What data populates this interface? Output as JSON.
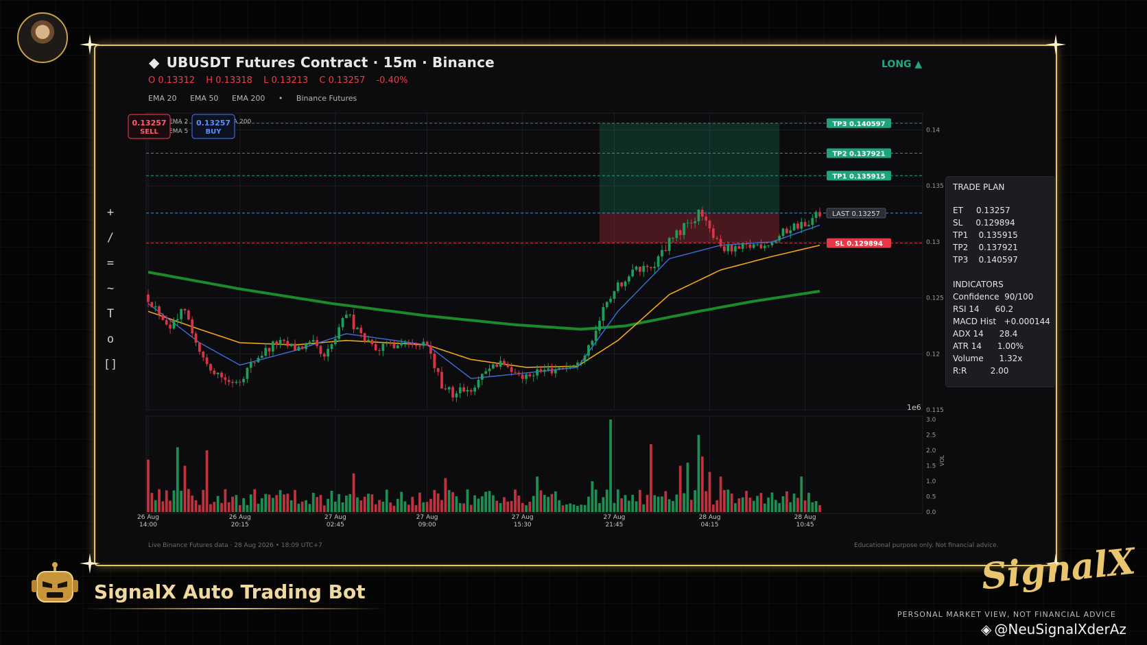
{
  "header": {
    "title": "UBUSDT Futures Contract  ·  15m  ·  Binance",
    "title_icon": "diamond-icon",
    "direction": "LONG ▲",
    "ohlc": {
      "o": "O 0.13312",
      "h": "H 0.13318",
      "l": "L 0.13213",
      "c": "C 0.13257",
      "chg": "-0.40%"
    },
    "legend": {
      "ema20": "EMA 20",
      "ema50": "EMA 50",
      "ema200": "EMA 200",
      "dot": "•",
      "source": "Binance Futures"
    }
  },
  "tools": [
    "+",
    "/",
    "=",
    "~",
    "T",
    "o",
    "[]"
  ],
  "overlay": {
    "sell_price": "0.13257",
    "sell_label": "SELL",
    "buy_price": "0.13257",
    "buy_label": "BUY",
    "legend_frag_1": "EMA 2",
    "legend_frag_2": "EMA 5",
    "legend_frag_3": "A 200"
  },
  "trade_plan": {
    "title": "TRADE PLAN",
    "rows": [
      "ET     0.13257",
      "SL     0.129894",
      "TP1    0.135915",
      "TP2    0.137921",
      "TP3    0.140597"
    ],
    "indicators_title": "INDICATORS",
    "indicators": [
      "Confidence  90/100",
      "RSI 14      60.2",
      "MACD Hist   +0.000144",
      "ADX 14      28.4",
      "ATR 14      1.00%",
      "Volume      1.32x",
      "R:R         2.00"
    ]
  },
  "footer": {
    "left": "Live Binance Futures data   ·   28 Aug 2026 • 18:09 UTC+7",
    "right": "Educational purpose only. Not financial advice."
  },
  "branding": {
    "bot_name": "SignalX Auto Trading Bot",
    "logo": "SignalX",
    "tagline": "PERSONAL MARKET VIEW, NOT FINANCIAL ADVICE",
    "handle": "@NeuSignalXderAz",
    "gold": "#e9c46a"
  },
  "chart_data": {
    "type": "candlestick",
    "symbol": "UBUSDT",
    "interval": "15m",
    "y_ticks": [
      0.115,
      0.12,
      0.125,
      0.13,
      0.135,
      0.14
    ],
    "ylim": [
      0.115,
      0.1415
    ],
    "y_offset_label": "1e6",
    "x_tick_labels": [
      {
        "date": "26 Aug",
        "time": "14:00",
        "index": 0
      },
      {
        "date": "26 Aug",
        "time": "20:15",
        "index": 25
      },
      {
        "date": "27 Aug",
        "time": "02:45",
        "index": 51
      },
      {
        "date": "27 Aug",
        "time": "09:00",
        "index": 76
      },
      {
        "date": "27 Aug",
        "time": "15:30",
        "index": 102
      },
      {
        "date": "27 Aug",
        "time": "21:45",
        "index": 127
      },
      {
        "date": "28 Aug",
        "time": "04:15",
        "index": 153
      },
      {
        "date": "28 Aug",
        "time": "10:45",
        "index": 179
      }
    ],
    "close_path": [
      [
        0,
        0.125
      ],
      [
        6,
        0.1225
      ],
      [
        10,
        0.124
      ],
      [
        14,
        0.12
      ],
      [
        18,
        0.1185
      ],
      [
        22,
        0.1175
      ],
      [
        25,
        0.1178
      ],
      [
        30,
        0.1198
      ],
      [
        35,
        0.121
      ],
      [
        40,
        0.1205
      ],
      [
        45,
        0.1208
      ],
      [
        48,
        0.1195
      ],
      [
        52,
        0.122
      ],
      [
        54,
        0.1237
      ],
      [
        58,
        0.1215
      ],
      [
        63,
        0.1205
      ],
      [
        68,
        0.121
      ],
      [
        72,
        0.1212
      ],
      [
        76,
        0.1208
      ],
      [
        80,
        0.117
      ],
      [
        83,
        0.1165
      ],
      [
        88,
        0.1168
      ],
      [
        92,
        0.1188
      ],
      [
        98,
        0.119
      ],
      [
        103,
        0.118
      ],
      [
        108,
        0.1185
      ],
      [
        112,
        0.1188
      ],
      [
        117,
        0.119
      ],
      [
        121,
        0.1215
      ],
      [
        125,
        0.1245
      ],
      [
        128,
        0.126
      ],
      [
        133,
        0.1275
      ],
      [
        138,
        0.128
      ],
      [
        142,
        0.13
      ],
      [
        146,
        0.1313
      ],
      [
        150,
        0.1325
      ],
      [
        152,
        0.1315
      ],
      [
        156,
        0.1295
      ],
      [
        160,
        0.1292
      ],
      [
        165,
        0.1297
      ],
      [
        170,
        0.13
      ],
      [
        175,
        0.1313
      ],
      [
        180,
        0.1318
      ],
      [
        183,
        0.1326
      ]
    ],
    "ema20_path": [
      [
        0,
        0.1245
      ],
      [
        14,
        0.121
      ],
      [
        25,
        0.119
      ],
      [
        40,
        0.1203
      ],
      [
        54,
        0.1218
      ],
      [
        76,
        0.1208
      ],
      [
        88,
        0.1178
      ],
      [
        103,
        0.1183
      ],
      [
        117,
        0.1188
      ],
      [
        128,
        0.1238
      ],
      [
        142,
        0.1285
      ],
      [
        156,
        0.1297
      ],
      [
        170,
        0.13
      ],
      [
        183,
        0.1315
      ]
    ],
    "ema50_path": [
      [
        0,
        0.1238
      ],
      [
        14,
        0.1222
      ],
      [
        25,
        0.121
      ],
      [
        40,
        0.1208
      ],
      [
        54,
        0.1212
      ],
      [
        76,
        0.1208
      ],
      [
        88,
        0.1195
      ],
      [
        103,
        0.1188
      ],
      [
        117,
        0.1189
      ],
      [
        128,
        0.1212
      ],
      [
        142,
        0.1253
      ],
      [
        156,
        0.1275
      ],
      [
        170,
        0.1287
      ],
      [
        183,
        0.1297
      ]
    ],
    "ema200_path": [
      [
        0,
        0.1273
      ],
      [
        25,
        0.1258
      ],
      [
        50,
        0.1245
      ],
      [
        76,
        0.1234
      ],
      [
        100,
        0.1226
      ],
      [
        118,
        0.1222
      ],
      [
        130,
        0.1225
      ],
      [
        150,
        0.1238
      ],
      [
        165,
        0.1247
      ],
      [
        183,
        0.1256
      ]
    ],
    "volume_ylim": [
      0,
      3.0
    ],
    "volume_ticks": [
      0.0,
      0.5,
      1.0,
      1.5,
      2.0,
      2.5,
      3.0
    ],
    "volume_axis_label": "VOL",
    "volume_spikes": [
      {
        "index": 0,
        "value": 1.7
      },
      {
        "index": 8,
        "value": 2.1
      },
      {
        "index": 10,
        "value": 1.5
      },
      {
        "index": 16,
        "value": 2.0
      },
      {
        "index": 56,
        "value": 1.25
      },
      {
        "index": 81,
        "value": 1.1
      },
      {
        "index": 106,
        "value": 1.15
      },
      {
        "index": 121,
        "value": 1.0
      },
      {
        "index": 126,
        "value": 3.0
      },
      {
        "index": 137,
        "value": 2.2
      },
      {
        "index": 145,
        "value": 1.5
      },
      {
        "index": 147,
        "value": 1.6
      },
      {
        "index": 150,
        "value": 2.5
      },
      {
        "index": 151,
        "value": 1.8
      },
      {
        "index": 153,
        "value": 1.3
      },
      {
        "index": 156,
        "value": 1.15
      },
      {
        "index": 178,
        "value": 1.15
      }
    ],
    "levels": [
      {
        "label": "TP3",
        "value": 0.140597,
        "color": "#1fa37d"
      },
      {
        "label": "TP2",
        "value": 0.137921,
        "color": "#1fa37d"
      },
      {
        "label": "TP1",
        "value": 0.135915,
        "color": "#1fa37d"
      },
      {
        "label": "LAST",
        "value": 0.13257,
        "color": "#4b8fd6"
      },
      {
        "label": "SL",
        "value": 0.129894,
        "color": "#e53945"
      }
    ],
    "zone": {
      "start_index": 123,
      "end_index": 172
    },
    "colors": {
      "up": "#1e9e5a",
      "down": "#d53645",
      "ema20": "#3b6fe0",
      "ema50": "#f3a51c",
      "ema200": "#1c8a2a",
      "grid": "#1d1e22"
    }
  }
}
